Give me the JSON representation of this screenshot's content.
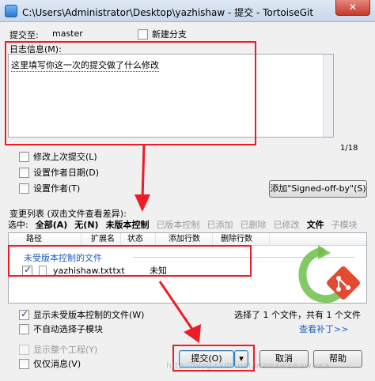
{
  "window": {
    "title": "C:\\Users\\Administrator\\Desktop\\yazhishaw - 提交 - TortoiseGit",
    "close_label": "✕"
  },
  "header": {
    "commit_to_label": "提交至:",
    "branch_value": "master",
    "new_branch_label": "新建分支"
  },
  "message": {
    "group_label": "日志信息(M):",
    "text": "这里填写你这一次的提交做了什么修改",
    "counter": "1/18"
  },
  "options": {
    "amend_label": "修改上次提交(L)",
    "set_author_date_label": "设置作者日期(D)",
    "set_author_label": "设置作者(T)",
    "signed_off_button": "添加\"Signed-off-by\"(S)"
  },
  "changes": {
    "title": "变更列表 (双击文件查看差异):",
    "select_label": "选中:",
    "tabs": [
      "全部(A)",
      "无(N)",
      "未版本控制",
      "已版本控制",
      "已添加",
      "已删除",
      "已修改",
      "文件",
      "子模块"
    ],
    "columns": [
      "路径",
      "扩展名",
      "状态",
      "添加行数",
      "删除行数"
    ],
    "group_name": "未受版本控制的文件",
    "files": [
      {
        "name": "yazhishaw.txt",
        "ext": ".txt",
        "status": "未知"
      }
    ],
    "show_unversioned_label": "显示未受版本控制的文件(W)",
    "no_auto_submodule_label": "不自动选择子模块",
    "summary": "选择了 1 个文件，共有 1 个文件",
    "view_patch_link": "查看补丁>>"
  },
  "footer": {
    "show_whole_project_label": "显示整个工程(Y)",
    "message_only_label": "仅仅消息(V)",
    "commit_button": "提交(O)",
    "cancel_button": "取消",
    "help_button": "帮助"
  },
  "watermark": "http://blog.csdn.net/wawawawawawa",
  "colors": {
    "annotation_red": "#ee1c25",
    "link_blue": "#1f5fbf",
    "git_green": "#6fbf4a",
    "git_red": "#e24b32"
  }
}
